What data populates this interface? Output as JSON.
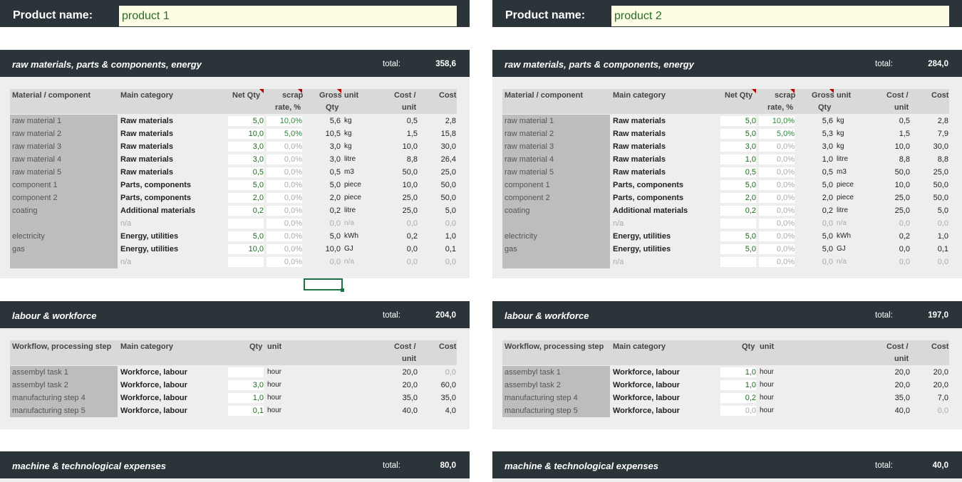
{
  "panels": [
    {
      "product_label": "Product name:",
      "product_name": "product 1",
      "materials": {
        "title": "raw materials, parts & components, energy",
        "total_label": "total:",
        "total": "358,6",
        "headers": {
          "name": "Material / component",
          "cat": "Main category",
          "net": "Net Qty",
          "scrap1": "scrap",
          "scrap2": "rate, %",
          "gross1": "Gross",
          "gross2": "Qty",
          "unit": "unit",
          "cu1": "Cost /",
          "cu2": "unit",
          "cost": "Cost"
        },
        "rows": [
          {
            "name": "raw material 1",
            "cat": "Raw materials",
            "net": "5,0",
            "scrap": "10,0%",
            "gross": "5,6",
            "unit": "kg",
            "cu": "0,5",
            "cost": "2,8"
          },
          {
            "name": "raw material 2",
            "cat": "Raw materials",
            "net": "10,0",
            "scrap": "5,0%",
            "gross": "10,5",
            "unit": "kg",
            "cu": "1,5",
            "cost": "15,8"
          },
          {
            "name": "raw material 3",
            "cat": "Raw materials",
            "net": "3,0",
            "scrap": "0,0%",
            "gross": "3,0",
            "unit": "kg",
            "cu": "10,0",
            "cost": "30,0"
          },
          {
            "name": "raw material 4",
            "cat": "Raw materials",
            "net": "3,0",
            "scrap": "0,0%",
            "gross": "3,0",
            "unit": "litre",
            "cu": "8,8",
            "cost": "26,4"
          },
          {
            "name": "raw material 5",
            "cat": "Raw materials",
            "net": "0,5",
            "scrap": "0,0%",
            "gross": "0,5",
            "unit": "m3",
            "cu": "50,0",
            "cost": "25,0"
          },
          {
            "name": "component 1",
            "cat": "Parts, components",
            "net": "5,0",
            "scrap": "0,0%",
            "gross": "5,0",
            "unit": "piece",
            "cu": "10,0",
            "cost": "50,0"
          },
          {
            "name": "component 2",
            "cat": "Parts, components",
            "net": "2,0",
            "scrap": "0,0%",
            "gross": "2,0",
            "unit": "piece",
            "cu": "25,0",
            "cost": "50,0"
          },
          {
            "name": "coating",
            "cat": "Additional materials",
            "net": "0,2",
            "scrap": "0,0%",
            "gross": "0,2",
            "unit": "litre",
            "cu": "25,0",
            "cost": "5,0"
          },
          {
            "name": "",
            "cat": "n/a",
            "net": "",
            "scrap": "0,0%",
            "gross": "0,0",
            "unit": "n/a",
            "cu": "0,0",
            "cost": "0,0",
            "empty": true
          },
          {
            "name": "electricity",
            "cat": "Energy, utilities",
            "net": "5,0",
            "scrap": "0,0%",
            "gross": "5,0",
            "unit": "kWh",
            "cu": "0,2",
            "cost": "1,0"
          },
          {
            "name": "gas",
            "cat": "Energy, utilities",
            "net": "10,0",
            "scrap": "0,0%",
            "gross": "10,0",
            "unit": "GJ",
            "cu": "0,0",
            "cost": "0,1"
          },
          {
            "name": "",
            "cat": "n/a",
            "net": "",
            "scrap": "0,0%",
            "gross": "0,0",
            "unit": "n/a",
            "cu": "0,0",
            "cost": "0,0",
            "empty": true
          }
        ]
      },
      "labour": {
        "title": "labour & workforce",
        "total_label": "total:",
        "total": "204,0",
        "headers": {
          "name": "Workflow, processing step",
          "cat": "Main category",
          "qty": "Qty",
          "unit": "unit",
          "cu1": "Cost /",
          "cu2": "unit",
          "cost": "Cost"
        },
        "rows": [
          {
            "name": "assembyl task 1",
            "cat": "Workforce, labour",
            "qty": "",
            "unit": "hour",
            "cu": "20,0",
            "cost": "0,0",
            "zero": true
          },
          {
            "name": "assembyl task 2",
            "cat": "Workforce, labour",
            "qty": "3,0",
            "unit": "hour",
            "cu": "20,0",
            "cost": "60,0"
          },
          {
            "name": "manufacturing step 4",
            "cat": "Workforce, labour",
            "qty": "1,0",
            "unit": "hour",
            "cu": "35,0",
            "cost": "35,0"
          },
          {
            "name": "manufacturing step 5",
            "cat": "Workforce, labour",
            "qty": "0,1",
            "unit": "hour",
            "cu": "40,0",
            "cost": "4,0"
          }
        ]
      },
      "machine": {
        "title": "machine & technological expenses",
        "total_label": "total:",
        "total": "80,0"
      }
    },
    {
      "product_label": "Product name:",
      "product_name": "product 2",
      "materials": {
        "title": "raw materials, parts & components, energy",
        "total_label": "total:",
        "total": "284,0",
        "headers": {
          "name": "Material / component",
          "cat": "Main category",
          "net": "Net Qty",
          "scrap1": "scrap",
          "scrap2": "rate, %",
          "gross1": "Gross",
          "gross2": "Qty",
          "unit": "unit",
          "cu1": "Cost /",
          "cu2": "unit",
          "cost": "Cost"
        },
        "rows": [
          {
            "name": "raw material 1",
            "cat": "Raw materials",
            "net": "5,0",
            "scrap": "10,0%",
            "gross": "5,6",
            "unit": "kg",
            "cu": "0,5",
            "cost": "2,8"
          },
          {
            "name": "raw material 2",
            "cat": "Raw materials",
            "net": "5,0",
            "scrap": "5,0%",
            "gross": "5,3",
            "unit": "kg",
            "cu": "1,5",
            "cost": "7,9"
          },
          {
            "name": "raw material 3",
            "cat": "Raw materials",
            "net": "3,0",
            "scrap": "0,0%",
            "gross": "3,0",
            "unit": "kg",
            "cu": "10,0",
            "cost": "30,0"
          },
          {
            "name": "raw material 4",
            "cat": "Raw materials",
            "net": "1,0",
            "scrap": "0,0%",
            "gross": "1,0",
            "unit": "litre",
            "cu": "8,8",
            "cost": "8,8"
          },
          {
            "name": "raw material 5",
            "cat": "Raw materials",
            "net": "0,5",
            "scrap": "0,0%",
            "gross": "0,5",
            "unit": "m3",
            "cu": "50,0",
            "cost": "25,0"
          },
          {
            "name": "component 1",
            "cat": "Parts, components",
            "net": "5,0",
            "scrap": "0,0%",
            "gross": "5,0",
            "unit": "piece",
            "cu": "10,0",
            "cost": "50,0"
          },
          {
            "name": "component 2",
            "cat": "Parts, components",
            "net": "2,0",
            "scrap": "0,0%",
            "gross": "2,0",
            "unit": "piece",
            "cu": "25,0",
            "cost": "50,0"
          },
          {
            "name": "coating",
            "cat": "Additional materials",
            "net": "0,2",
            "scrap": "0,0%",
            "gross": "0,2",
            "unit": "litre",
            "cu": "25,0",
            "cost": "5,0"
          },
          {
            "name": "",
            "cat": "n/a",
            "net": "",
            "scrap": "0,0%",
            "gross": "0,0",
            "unit": "n/a",
            "cu": "0,0",
            "cost": "0,0",
            "empty": true
          },
          {
            "name": "electricity",
            "cat": "Energy, utilities",
            "net": "5,0",
            "scrap": "0,0%",
            "gross": "5,0",
            "unit": "kWh",
            "cu": "0,2",
            "cost": "1,0"
          },
          {
            "name": "gas",
            "cat": "Energy, utilities",
            "net": "5,0",
            "scrap": "0,0%",
            "gross": "5,0",
            "unit": "GJ",
            "cu": "0,0",
            "cost": "0,1"
          },
          {
            "name": "",
            "cat": "n/a",
            "net": "",
            "scrap": "0,0%",
            "gross": "0,0",
            "unit": "n/a",
            "cu": "0,0",
            "cost": "0,0",
            "empty": true
          }
        ]
      },
      "labour": {
        "title": "labour & workforce",
        "total_label": "total:",
        "total": "197,0",
        "headers": {
          "name": "Workflow, processing step",
          "cat": "Main category",
          "qty": "Qty",
          "unit": "unit",
          "cu1": "Cost /",
          "cu2": "unit",
          "cost": "Cost"
        },
        "rows": [
          {
            "name": "assembyl task 1",
            "cat": "Workforce, labour",
            "qty": "1,0",
            "unit": "hour",
            "cu": "20,0",
            "cost": "20,0"
          },
          {
            "name": "assembyl task 2",
            "cat": "Workforce, labour",
            "qty": "1,0",
            "unit": "hour",
            "cu": "20,0",
            "cost": "20,0"
          },
          {
            "name": "manufacturing step 4",
            "cat": "Workforce, labour",
            "qty": "0,2",
            "unit": "hour",
            "cu": "35,0",
            "cost": "7,0"
          },
          {
            "name": "manufacturing step 5",
            "cat": "Workforce, labour",
            "qty": "0,0",
            "unit": "hour",
            "cu": "40,0",
            "cost": "0,0",
            "zero": true
          }
        ]
      },
      "machine": {
        "title": "machine & technological expenses",
        "total_label": "total:",
        "total": "40,0"
      }
    }
  ]
}
